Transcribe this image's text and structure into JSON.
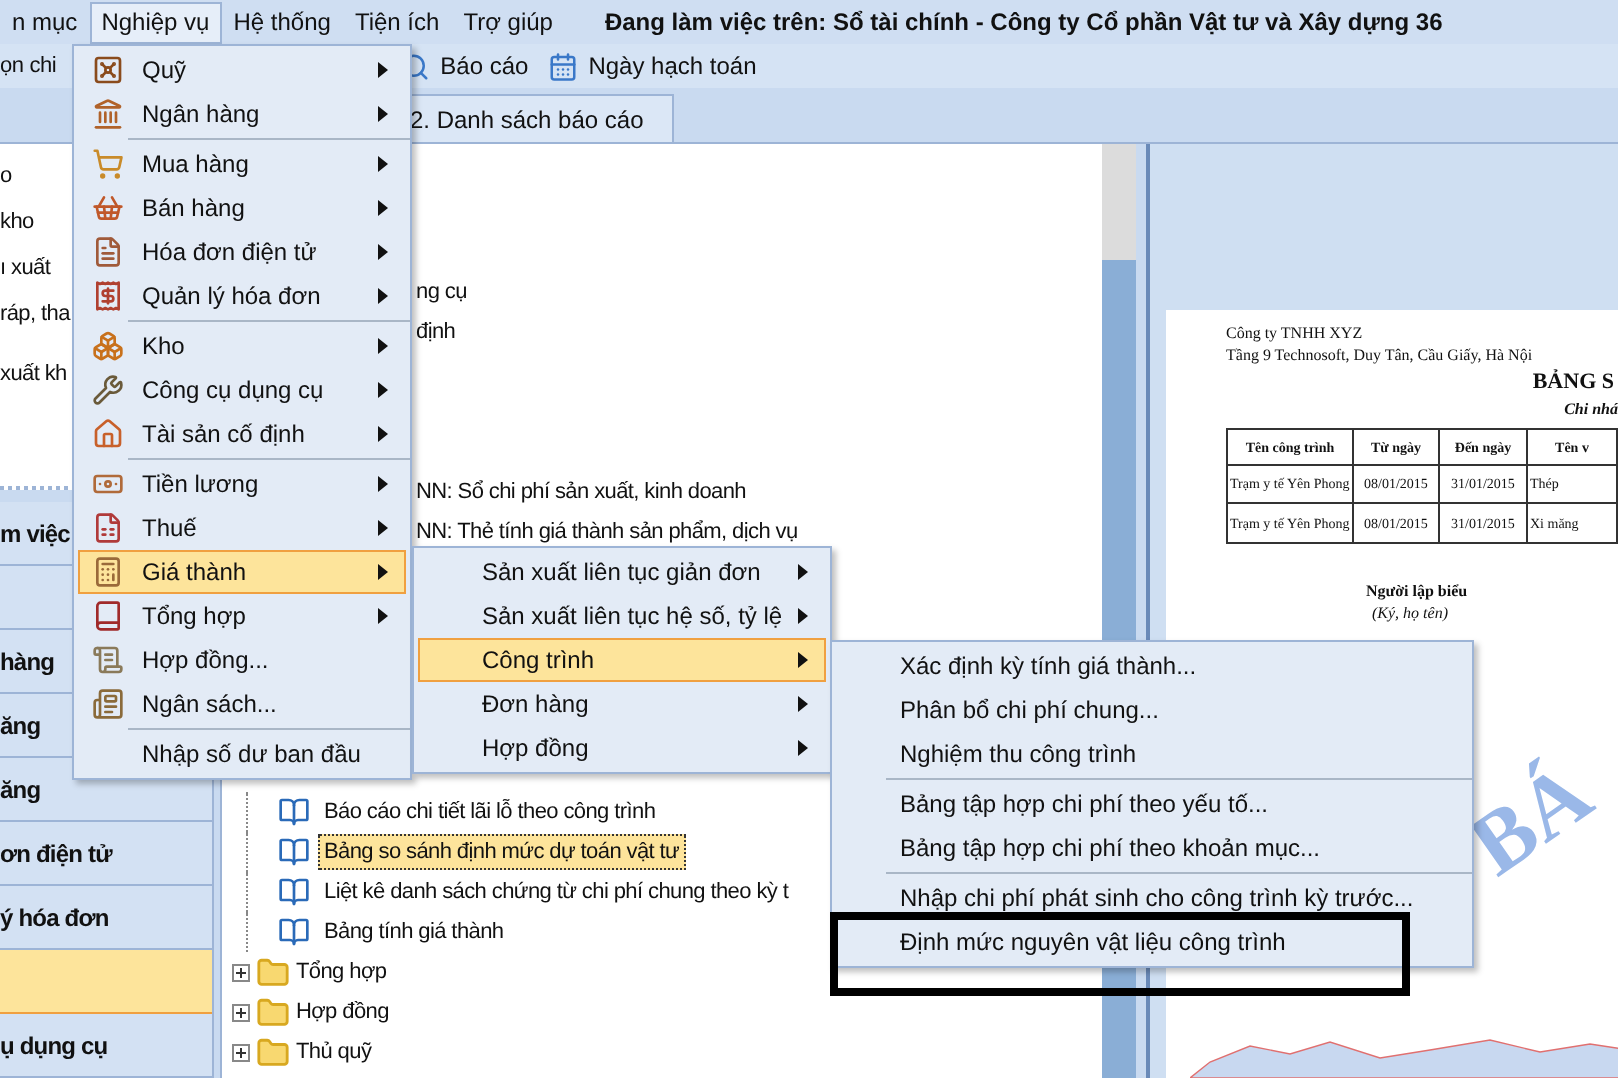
{
  "menu_bar": {
    "items": [
      {
        "label": "n mục",
        "selected": false
      },
      {
        "label": "Nghiệp vụ",
        "selected": true
      },
      {
        "label": "Hệ thống",
        "selected": false
      },
      {
        "label": "Tiện ích",
        "selected": false
      },
      {
        "label": "Trợ giúp",
        "selected": false
      }
    ],
    "title": "Đang làm việc trên: Sổ tài chính - Công ty Cổ phần Vật tư và Xây dựng 36"
  },
  "toolbar": {
    "cut_label": "ọn chi",
    "buttons": [
      "Báo cáo",
      "Ngày hạch toán"
    ]
  },
  "tab": {
    "label": "2. Danh sách báo cáo"
  },
  "left_panel": {
    "lines": [
      "o",
      "kho",
      "ı xuất",
      "ráp, tha",
      "xuất kh"
    ],
    "nav": [
      {
        "label": "m việc",
        "selected": false
      },
      {
        "selected": false
      },
      {
        "label": "hàng",
        "selected": false
      },
      {
        "label": "ăng",
        "selected": false
      },
      {
        "label": "ăng",
        "selected": false
      },
      {
        "label": "ơn điện tử",
        "selected": false
      },
      {
        "label": "ý hóa đơn",
        "selected": false
      },
      {
        "selected": true
      },
      {
        "label": "ụ dụng cụ",
        "selected": false
      }
    ]
  },
  "tree": {
    "cut_lines": [
      "ng cụ",
      "định",
      "NN: Sổ chi phí sản xuất, kinh doanh",
      "NN: Thẻ tính giá thành sản phẩm, dịch vụ"
    ],
    "reports": [
      {
        "label": "Báo cáo chi tiết lãi lỗ theo công trình",
        "selected": false
      },
      {
        "label": "Bảng so sánh định mức dự toán vật tư",
        "selected": true
      },
      {
        "label": "Liệt kê danh sách chứng từ chi phí chung theo kỳ t",
        "selected": false
      },
      {
        "label": "Bảng tính giá thành",
        "selected": false
      }
    ],
    "folders": [
      {
        "label": "Tổng hợp",
        "expanded": false
      },
      {
        "label": "Hợp đồng",
        "expanded": false
      },
      {
        "label": "Thủ quỹ",
        "expanded": false
      }
    ]
  },
  "preview": {
    "company": "Công ty TNHH XYZ",
    "address": "Tầng 9 Technosoft, Duy Tân, Cầu Giấy, Hà Nội",
    "title": "BẢNG S",
    "subtitle": "Chi nhá",
    "table": {
      "columns": [
        "Tên công trình",
        "Từ ngày",
        "Đến ngày",
        "Tên v"
      ],
      "rows": [
        [
          "Trạm y tế Yên Phong",
          "08/01/2015",
          "31/01/2015",
          "Thép"
        ],
        [
          "Trạm y tế Yên Phong",
          "08/01/2015",
          "31/01/2015",
          "Xi măng"
        ]
      ]
    },
    "signer": "Người lập biểu",
    "signer_note": "(Ký, họ tên)",
    "stamp": "BÁ"
  },
  "menu": [
    {
      "kind": "item",
      "label": "Quỹ",
      "submenu": true,
      "selected": false
    },
    {
      "kind": "item",
      "label": "Ngân hàng",
      "submenu": true,
      "selected": false
    },
    {
      "kind": "separator"
    },
    {
      "kind": "item",
      "label": "Mua hàng",
      "submenu": true,
      "selected": false
    },
    {
      "kind": "item",
      "label": "Bán hàng",
      "submenu": true,
      "selected": false
    },
    {
      "kind": "item",
      "label": "Hóa đơn điện tử",
      "submenu": true,
      "selected": false
    },
    {
      "kind": "item",
      "label": "Quản lý hóa đơn",
      "submenu": true,
      "selected": false
    },
    {
      "kind": "separator"
    },
    {
      "kind": "item",
      "label": "Kho",
      "submenu": true,
      "selected": false
    },
    {
      "kind": "item",
      "label": "Công cụ dụng cụ",
      "submenu": true,
      "selected": false
    },
    {
      "kind": "item",
      "label": "Tài sản cố định",
      "submenu": true,
      "selected": false
    },
    {
      "kind": "separator"
    },
    {
      "kind": "item",
      "label": "Tiền lương",
      "submenu": true,
      "selected": false
    },
    {
      "kind": "item",
      "label": "Thuế",
      "submenu": true,
      "selected": false
    },
    {
      "kind": "item",
      "label": "Giá thành",
      "submenu": true,
      "selected": true
    },
    {
      "kind": "item",
      "label": "Tổng hợp",
      "submenu": true,
      "selected": false
    },
    {
      "kind": "item",
      "label": "Hợp đồng...",
      "submenu": false,
      "selected": false
    },
    {
      "kind": "item",
      "label": "Ngân sách...",
      "submenu": false,
      "selected": false
    },
    {
      "kind": "separator"
    },
    {
      "kind": "item",
      "label": "Nhập số dư ban đầu",
      "submenu": false,
      "selected": false
    }
  ],
  "submenu": [
    {
      "kind": "item",
      "label": "Sản xuất liên tục giản đơn",
      "submenu": true,
      "selected": false
    },
    {
      "kind": "item",
      "label": "Sản xuất liên tục hệ số, tỷ lệ",
      "submenu": true,
      "selected": false
    },
    {
      "kind": "item",
      "label": "Công trình",
      "submenu": true,
      "selected": true
    },
    {
      "kind": "item",
      "label": "Đơn hàng",
      "submenu": true,
      "selected": false
    },
    {
      "kind": "item",
      "label": "Hợp đồng",
      "submenu": true,
      "selected": false
    }
  ],
  "submenu_2": [
    {
      "kind": "item",
      "label": "Xác định kỳ tính giá thành...",
      "submenu": false,
      "selected": false
    },
    {
      "kind": "item",
      "label": "Phân bổ chi phí chung...",
      "submenu": false,
      "selected": false
    },
    {
      "kind": "item",
      "label": "Nghiệm thu công trình",
      "submenu": false,
      "selected": false
    },
    {
      "kind": "separator"
    },
    {
      "kind": "item",
      "label": "Bảng tập hợp chi phí theo yếu tố...",
      "submenu": false,
      "selected": false
    },
    {
      "kind": "item",
      "label": "Bảng tập hợp chi phí theo khoản mục...",
      "submenu": false,
      "selected": false
    },
    {
      "kind": "separator"
    },
    {
      "kind": "item",
      "label": "Nhập chi phí phát sinh cho công trình kỳ trước...",
      "submenu": false,
      "selected": false
    },
    {
      "kind": "item",
      "label": "Định mức nguyên vật liệu công trình",
      "submenu": false,
      "selected": false
    }
  ]
}
